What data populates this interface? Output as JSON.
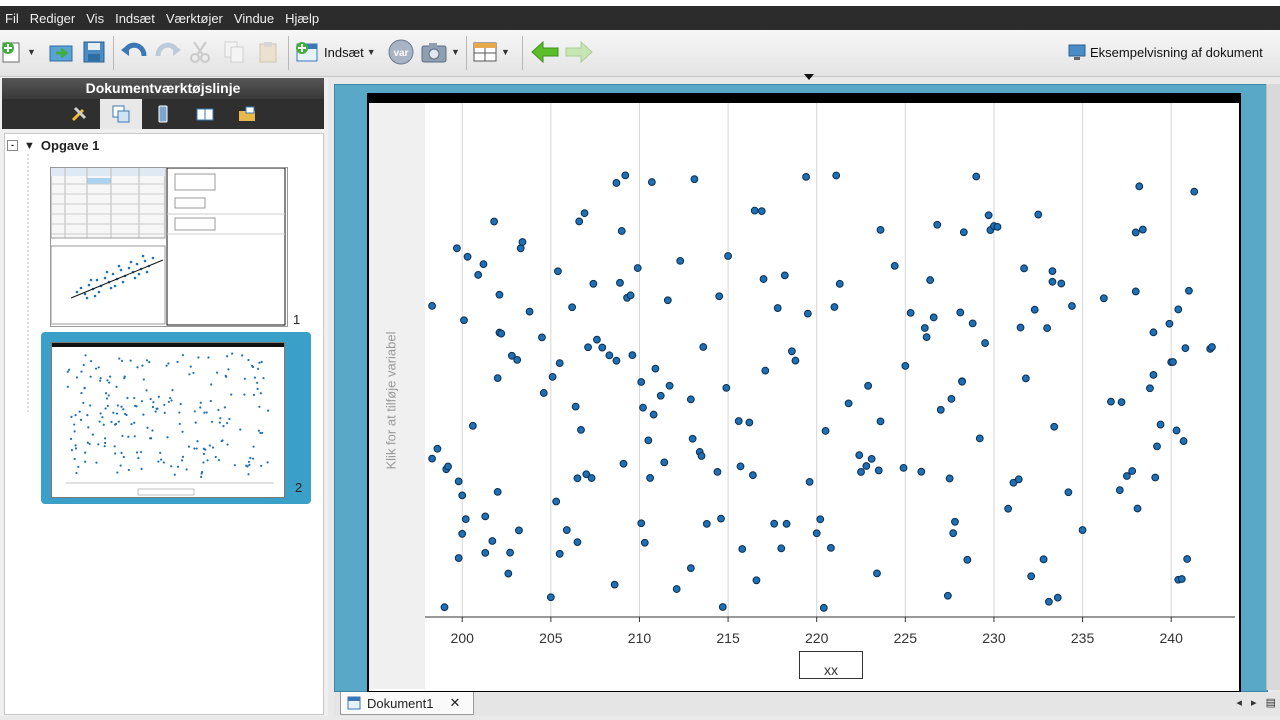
{
  "menu": [
    "Fil",
    "Rediger",
    "Vis",
    "Indsæt",
    "Værktøjer",
    "Vindue",
    "Hjælp"
  ],
  "toolbar": {
    "insert_label": "Indsæt",
    "var_label": "var",
    "preview_label": "Eksempelvisning af dokument"
  },
  "left_panel": {
    "title": "Dokumentværktøjslinje",
    "problem_label": "Opgave 1",
    "page1_number": "1",
    "page2_number": "2"
  },
  "document_tab": {
    "label": "Dokument1",
    "close": "✕"
  },
  "nav": {
    "prev": "◂",
    "next": "▸"
  },
  "plot": {
    "y_placeholder": "Klik for at tilføje variabel",
    "x_variable": "xx"
  },
  "chart_data": {
    "type": "scatter",
    "xlabel": "xx",
    "ylabel": "Klik for at tilføje variabel",
    "x_ticks": [
      200,
      205,
      210,
      215,
      220,
      225,
      230,
      235,
      240
    ],
    "xlim": [
      197.9,
      243.6
    ],
    "grid": true,
    "point_color": "#1f6fb4",
    "x": [
      198.3,
      198.3,
      198.6,
      199.0,
      199.1,
      199.2,
      199.7,
      199.8,
      199.8,
      200.0,
      200.0,
      200.1,
      200.2,
      200.3,
      200.6,
      200.9,
      201.2,
      201.3,
      201.3,
      201.7,
      201.8,
      202.0,
      202.0,
      202.1,
      202.1,
      202.2,
      202.6,
      202.7,
      202.8,
      203.1,
      203.2,
      203.3,
      203.4,
      203.8,
      204.5,
      204.6,
      205.0,
      205.1,
      205.3,
      205.4,
      205.5,
      205.5,
      205.9,
      206.2,
      206.4,
      206.5,
      206.5,
      206.6,
      206.7,
      206.9,
      207.0,
      207.1,
      207.3,
      207.4,
      207.6,
      207.9,
      208.3,
      208.6,
      208.7,
      208.7,
      208.9,
      209.0,
      209.1,
      209.2,
      209.3,
      209.5,
      209.6,
      209.9,
      210.1,
      210.1,
      210.2,
      210.3,
      210.5,
      210.6,
      210.7,
      210.8,
      210.9,
      211.2,
      211.4,
      211.6,
      211.7,
      212.1,
      212.3,
      212.9,
      212.9,
      213.0,
      213.1,
      213.4,
      213.5,
      213.6,
      213.8,
      214.4,
      214.5,
      214.6,
      214.7,
      214.9,
      215.0,
      215.6,
      215.7,
      215.8,
      216.2,
      216.4,
      216.5,
      216.6,
      216.9,
      217.0,
      217.1,
      217.6,
      217.8,
      218.0,
      218.2,
      218.3,
      218.6,
      218.8,
      219.4,
      219.5,
      219.6,
      220.0,
      220.2,
      220.4,
      220.5,
      220.8,
      221.0,
      221.1,
      221.3,
      221.8,
      222.4,
      222.5,
      222.8,
      222.9,
      223.1,
      223.4,
      223.5,
      223.6,
      223.6,
      224.4,
      224.9,
      225.0,
      225.3,
      225.9,
      226.1,
      226.2,
      226.4,
      226.6,
      226.8,
      227.0,
      227.4,
      227.5,
      227.6,
      227.7,
      227.8,
      228.1,
      228.2,
      228.2,
      228.3,
      228.5,
      228.8,
      229.0,
      229.2,
      229.5,
      229.7,
      229.8,
      230.0,
      230.2,
      230.8,
      231.1,
      231.4,
      231.5,
      231.7,
      231.8,
      232.1,
      232.3,
      232.5,
      232.8,
      233.0,
      233.1,
      233.3,
      233.3,
      233.4,
      233.6,
      233.8,
      234.2,
      234.4,
      235.0,
      236.2,
      236.6,
      237.1,
      237.2,
      237.5,
      237.8,
      238.0,
      238.0,
      238.1,
      238.2,
      238.4,
      238.8,
      239.0,
      239.0,
      239.1,
      239.2,
      239.4,
      239.9,
      240.0,
      240.1,
      240.3,
      240.4,
      240.4,
      240.6,
      240.7,
      240.8,
      240.9,
      241.0,
      241.3,
      242.2,
      242.3
    ]
  }
}
